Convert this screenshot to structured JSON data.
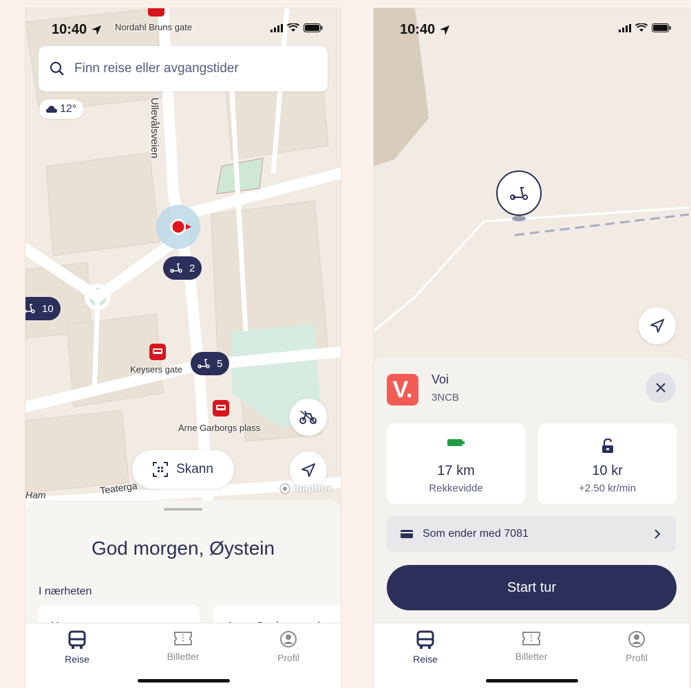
{
  "status": {
    "time": "10:40"
  },
  "screen1": {
    "map": {
      "top_street": "Nordahl Bruns gate",
      "street_vertical": "Ullevålsveien",
      "street_bottom": "Teaterga",
      "street_bottom2": "Ham",
      "stop_1": "Keysers gate",
      "stop_2": "Arne Garborgs plass",
      "scooters_a": "2",
      "scooters_b": "10",
      "scooters_c": "5",
      "attribution": "mapbox"
    },
    "search": {
      "placeholder": "Finn reise eller avgangstider"
    },
    "weather": {
      "temperature": "12°"
    },
    "scan_label": "Skann",
    "sheet": {
      "greeting": "God morgen, Øystein",
      "nearby_label": "I nærheten",
      "cards": [
        "Keysers gate",
        "Arne Garborgs plas"
      ]
    }
  },
  "screen2": {
    "operator": {
      "logo": "V.",
      "name": "Voi",
      "code": "3NCB"
    },
    "range": {
      "value": "17 km",
      "label": "Rekkevidde"
    },
    "price": {
      "value": "10 kr",
      "label": "+2.50 kr/min"
    },
    "payment": {
      "label": "Som ender med 7081"
    },
    "start_label": "Start tur"
  },
  "tabs": [
    {
      "label": "Reise",
      "active": true
    },
    {
      "label": "Billetter",
      "active": false
    },
    {
      "label": "Profil",
      "active": false
    }
  ],
  "colors": {
    "primary": "#2b2f59",
    "stop_red": "#d8151d",
    "voi": "#f35c55",
    "battery": "#1f9d43"
  }
}
